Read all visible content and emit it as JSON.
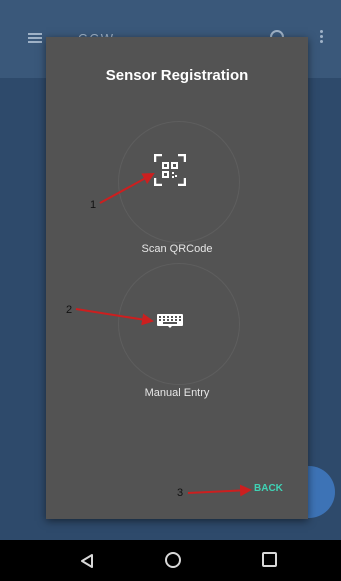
{
  "background_app": {
    "title": "CCW",
    "icons": [
      "menu-icon",
      "search-icon",
      "more-vert-icon",
      "fab-button"
    ]
  },
  "dialog": {
    "title": "Sensor Registration",
    "options": [
      {
        "label": "Scan QRCode",
        "icon": "qr-code-scan-icon"
      },
      {
        "label": "Manual Entry",
        "icon": "keyboard-icon"
      }
    ],
    "back_label": "BACK"
  },
  "annotations": [
    {
      "number": "1",
      "points_to": "qr-code-scan-icon"
    },
    {
      "number": "2",
      "points_to": "keyboard-icon"
    },
    {
      "number": "3",
      "points_to": "back-button"
    }
  ],
  "colors": {
    "dialog_bg": "#535353",
    "back_accent": "#3fd3b5",
    "arrow": "#cc1f1f",
    "nav_bar": "#000000"
  },
  "navbar": {
    "icons": [
      "nav-back-icon",
      "nav-home-icon",
      "nav-recents-icon"
    ]
  }
}
